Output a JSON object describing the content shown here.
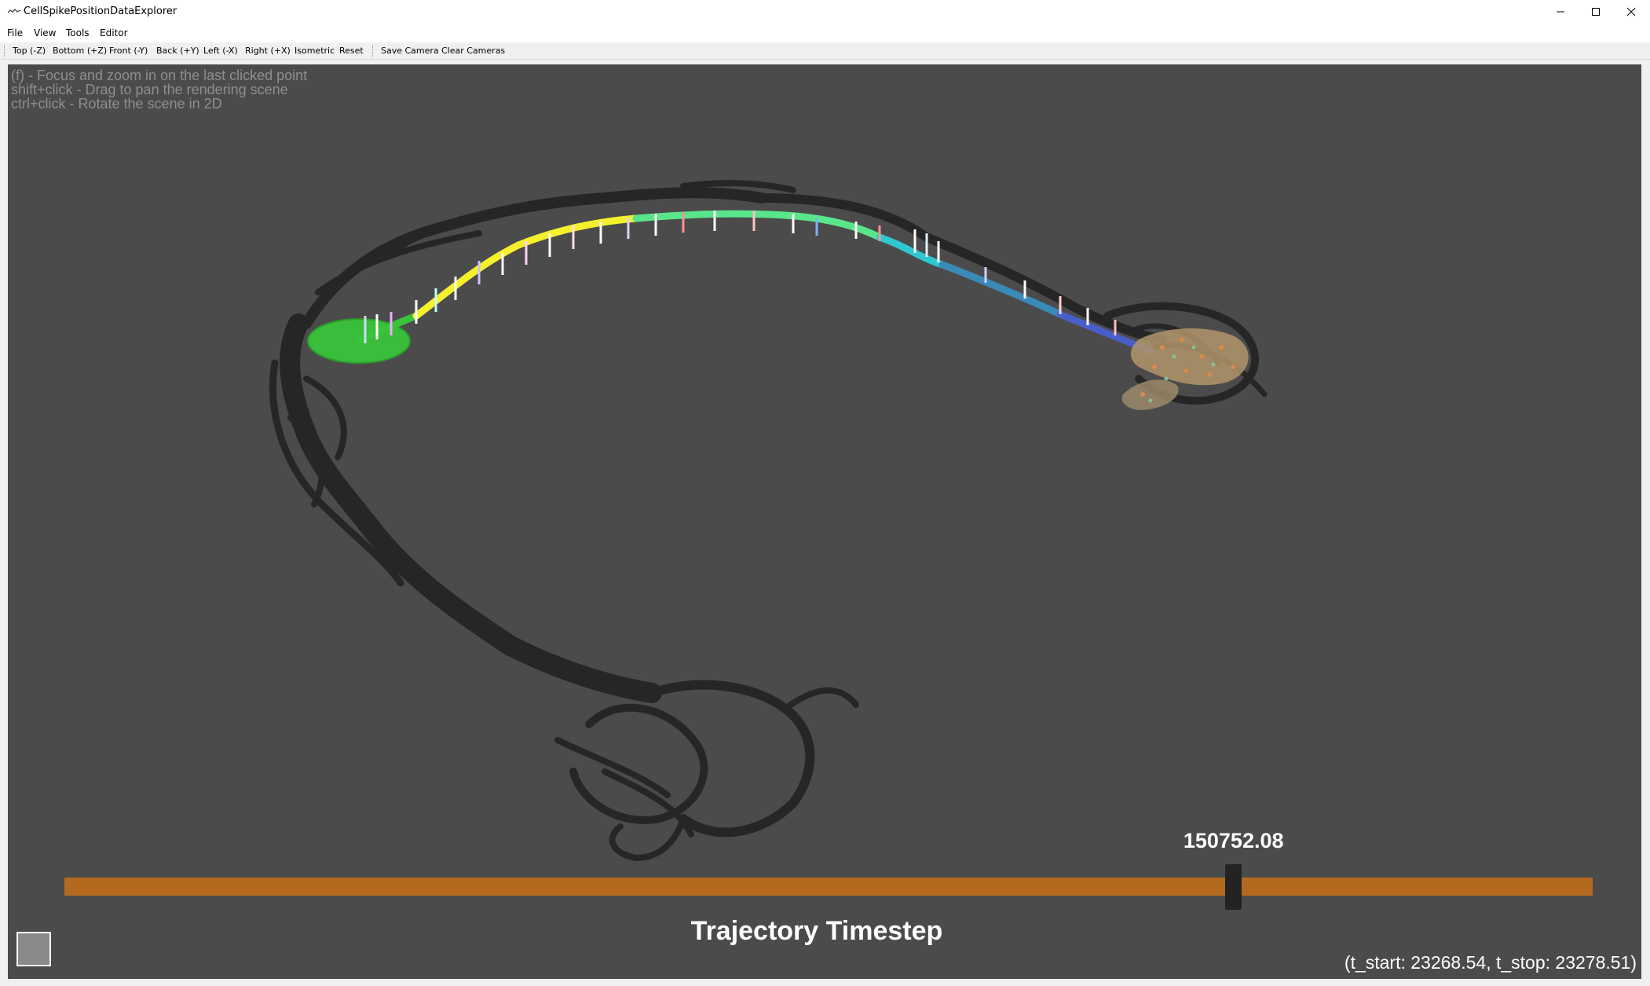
{
  "window": {
    "title": "CellSpikePositionDataExplorer",
    "controls": [
      "minimize-icon",
      "maximize-icon",
      "close-icon"
    ]
  },
  "menubar": {
    "items": [
      {
        "label": "File"
      },
      {
        "label": "View"
      },
      {
        "label": "Tools"
      },
      {
        "label": "Editor"
      }
    ]
  },
  "toolbar": {
    "views": [
      {
        "label": "Top (-Z)"
      },
      {
        "label": "Bottom (+Z)"
      },
      {
        "label": "Front (-Y)"
      },
      {
        "label": "Back (+Y)"
      },
      {
        "label": "Left (-X)"
      },
      {
        "label": "Right (+X)"
      },
      {
        "label": "Isometric"
      },
      {
        "label": "Reset"
      }
    ],
    "camera": [
      {
        "label": "Save Camera"
      },
      {
        "label": "Clear Cameras"
      }
    ]
  },
  "viewport": {
    "background": "#4b4b4b",
    "hints": [
      "(f) - Focus and zoom in on the last clicked point",
      "shift+click - Drag to pan the rendering scene",
      "ctrl+click - Rotate the scene in 2D"
    ],
    "track_colors": [
      "#39c43a",
      "#f5f02e",
      "#59e68a",
      "#2fc8d1",
      "#4a5ec9"
    ],
    "shadow_color": "#262626"
  },
  "timestep_slider": {
    "value": "150752.08",
    "position_fraction": 0.765,
    "title": "Trajectory Timestep",
    "track_color": "#b36a1e"
  },
  "time_range": "(t_start: 23268.54, t_stop: 23278.51)"
}
